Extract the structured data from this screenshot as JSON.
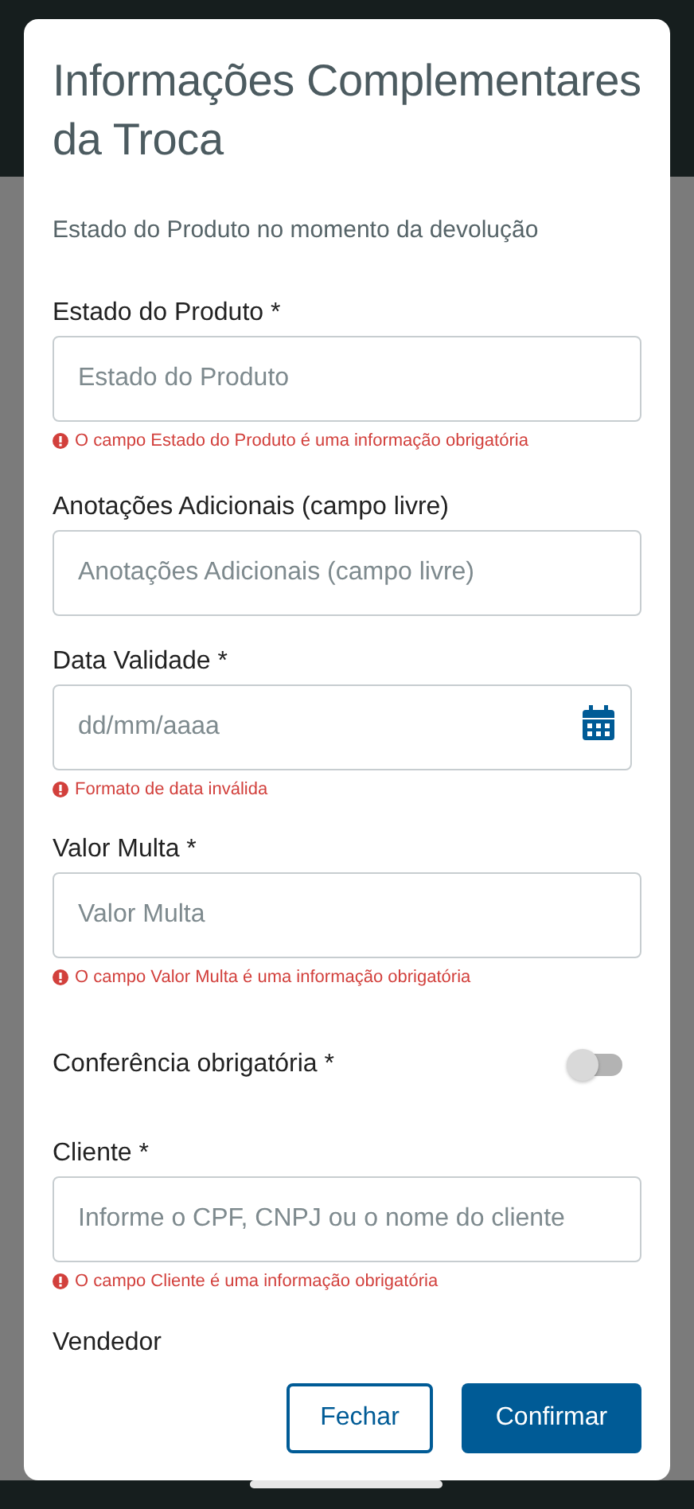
{
  "dialog": {
    "title": "Informações Complementares da Troca",
    "subtitle": "Estado do Produto no momento da devolução"
  },
  "fields": [
    {
      "kind": "text",
      "label": "Estado do Produto *",
      "placeholder": "Estado do Produto",
      "error": "O campo Estado do Produto é uma informação obrigatória"
    },
    {
      "kind": "text",
      "label": "Anotações Adicionais (campo livre)",
      "placeholder": "Anotações Adicionais (campo livre)"
    },
    {
      "kind": "date",
      "label": "Data Validade *",
      "placeholder": "dd/mm/aaaa",
      "error": "Formato de data inválida"
    },
    {
      "kind": "text",
      "label": "Valor Multa *",
      "placeholder": "Valor Multa",
      "error": "O campo Valor Multa é uma informação obrigatória"
    },
    {
      "kind": "toggle",
      "label": "Conferência obrigatória *",
      "on": false
    },
    {
      "kind": "text",
      "label": "Cliente *",
      "placeholder": "Informe o CPF, CNPJ ou o nome do cliente",
      "error": "O campo Cliente é uma informação obrigatória"
    },
    {
      "kind": "heading",
      "label": "Vendedor"
    }
  ],
  "buttons": [
    {
      "label": "Fechar",
      "kind": "secondary"
    },
    {
      "label": "Confirmar",
      "kind": "primary"
    }
  ]
}
